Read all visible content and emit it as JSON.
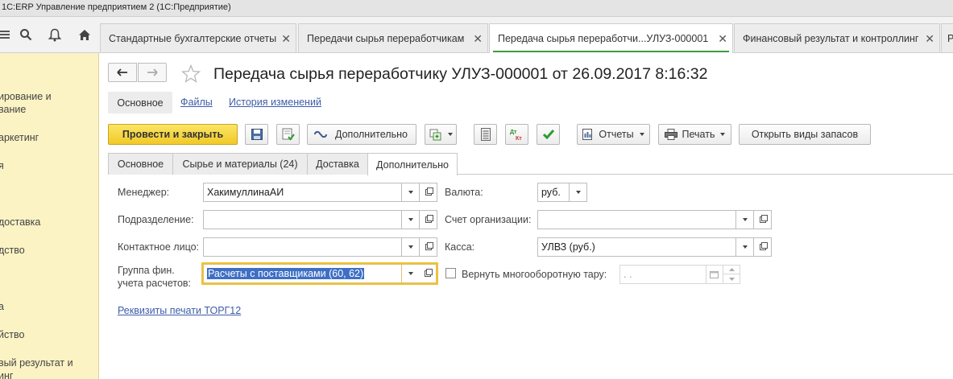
{
  "window": {
    "title": "1С:ERP Управление предприятием 2  (1С:Предприятие)"
  },
  "tabs": [
    {
      "label": "Стандартные бухгалтерские отчеты"
    },
    {
      "label": "Передачи сырья переработчикам"
    },
    {
      "label": "Передача сырья переработчи...УЛУЗ-000001"
    },
    {
      "label": "Финансовый результат и контроллинг"
    },
    {
      "label": "Р"
    }
  ],
  "sidebar": {
    "items": [
      {
        "label": "ирование и"
      },
      {
        "label": "вание"
      },
      {
        "label": "аркетинг"
      },
      {
        "label": "я"
      },
      {
        "label": "доставка"
      },
      {
        "label": "дство"
      },
      {
        "label": "а"
      },
      {
        "label": "йство"
      },
      {
        "label": "вый результат и"
      },
      {
        "label": "инг"
      }
    ]
  },
  "form": {
    "title": "Передача сырья переработчику УЛУЗ-000001 от 26.09.2017 8:16:32",
    "nav": {
      "main": "Основное",
      "files": "Файлы",
      "history": "История изменений"
    }
  },
  "commandbar": {
    "post_close": "Провести и закрыть",
    "more": "Дополнительно",
    "reports": "Отчеты",
    "print": "Печать",
    "open_stock_types": "Открыть виды запасов",
    "dtkt_top": "Дт",
    "dtkt_bottom": "Кт"
  },
  "page_tabs": [
    {
      "label": "Основное"
    },
    {
      "label": "Сырье и материалы (24)"
    },
    {
      "label": "Доставка"
    },
    {
      "label": "Дополнительно"
    }
  ],
  "fields": {
    "manager": {
      "label": "Менеджер:",
      "value": "ХакимуллинаАИ"
    },
    "department": {
      "label": "Подразделение:",
      "value": ""
    },
    "contact": {
      "label": "Контактное лицо:",
      "value": ""
    },
    "fin_group": {
      "label_line1": "Группа фин.",
      "label_line2": "учета расчетов:",
      "value": "Расчеты с поставщиками (60, 62)"
    },
    "currency": {
      "label": "Валюта:",
      "value": "руб."
    },
    "org_account": {
      "label": "Счет организации:",
      "value": ""
    },
    "cashbox": {
      "label": "Касса:",
      "value": "УЛВЗ (руб.)"
    },
    "return_tare": {
      "label": "Вернуть многооборотную тару:",
      "checked": false,
      "date_placeholder": " .  ."
    }
  },
  "print_requisites_link": "Реквизиты печати ТОРГ12",
  "colors": {
    "sidebar_bg": "#fbf3c4",
    "primary_button": "#f1c928",
    "selection": "#3e6fc4",
    "link": "#3d5ca8",
    "active_tab_underline": "#3c9b3c"
  }
}
